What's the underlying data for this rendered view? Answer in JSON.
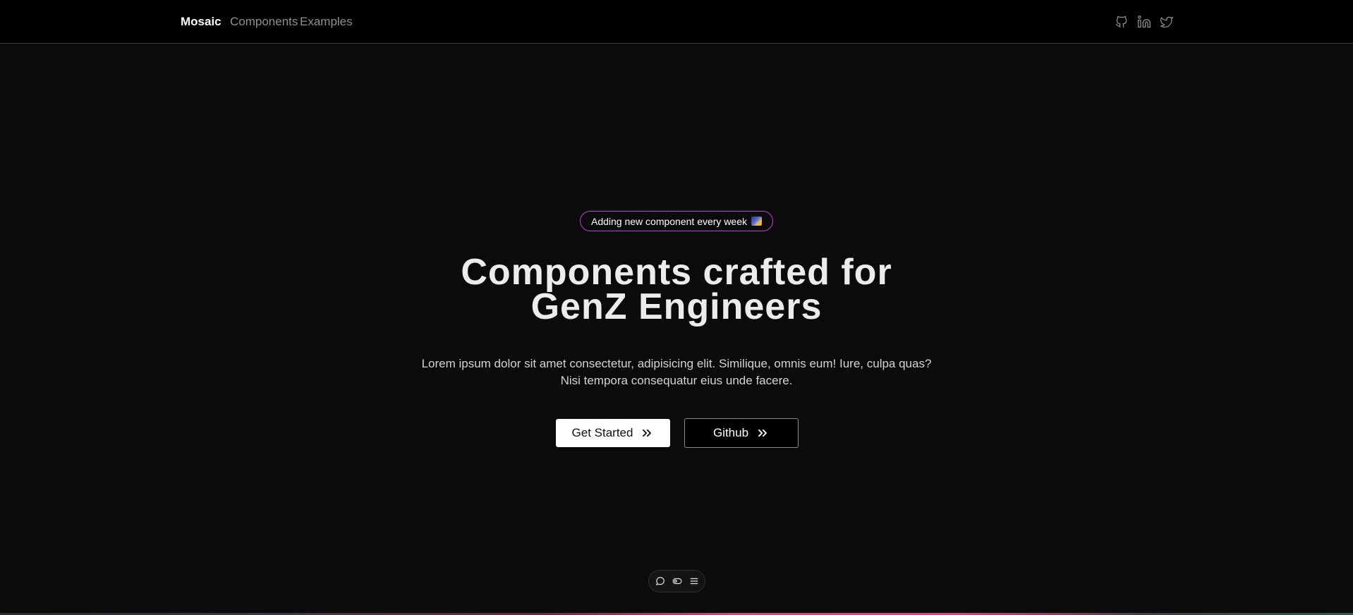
{
  "nav": {
    "brand": "Mosaic",
    "links": [
      "Components",
      "Examples"
    ],
    "social_icons": [
      "github-icon",
      "linkedin-icon",
      "twitter-icon"
    ]
  },
  "hero": {
    "badge_text": "Adding new component every week",
    "badge_icon": "milky-way-emoji-icon",
    "headline_line1": "Components crafted for",
    "headline_line2": "GenZ Engineers",
    "subtext_line1": "Lorem ipsum dolor sit amet consectetur, adipisicing elit. Similique, omnis eum! Iure, culpa quas?",
    "subtext_line2": "Nisi tempora consequatur eius unde facere.",
    "primary_button": "Get Started",
    "secondary_button": "Github",
    "button_icon": "chevrons-right-icon"
  },
  "dock": {
    "icons": [
      "chat-bubble-icon",
      "toggle-icon",
      "menu-icon"
    ]
  },
  "colors": {
    "background": "#0b0b0b",
    "navbar": "#000000",
    "badge_border": "#c13bd6",
    "headline": "#ececec",
    "muted_text": "#8f8f8f"
  }
}
